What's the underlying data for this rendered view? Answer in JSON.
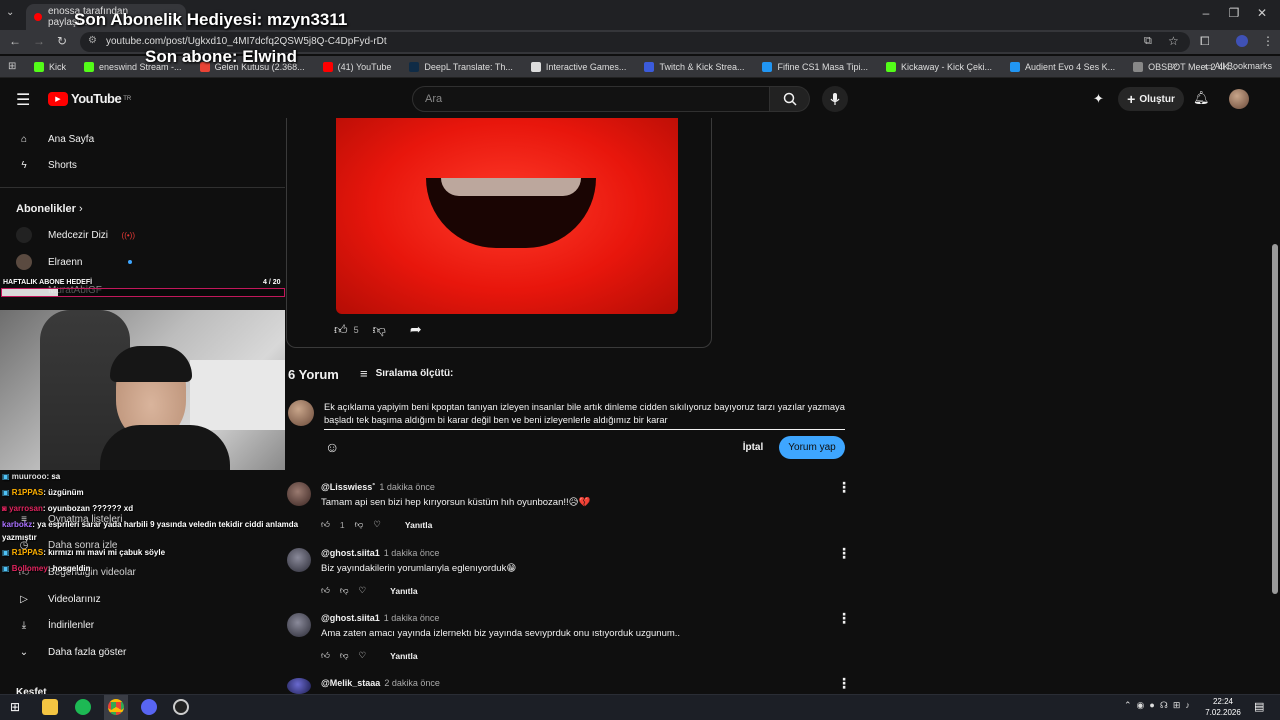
{
  "browser": {
    "tab_title": "enossa tarafından paylaşıl...",
    "tab_close": "×",
    "url": "youtube.com/post/Ugkxd10_4MI7dcfq2QSW5j8Q-C4DpFyd-rDt",
    "bookmarks": [
      {
        "label": "Kick",
        "color": "#53fc18"
      },
      {
        "label": "eneswind Stream -...",
        "color": "#53fc18"
      },
      {
        "label": "Gelen Kutusu (2.368...",
        "color": "#ea4335"
      },
      {
        "label": "(41) YouTube",
        "color": "#ff0000"
      },
      {
        "label": "DeepL Translate: Th...",
        "color": "#0f2b46"
      },
      {
        "label": "Interactive Games...",
        "color": "#dddddd"
      },
      {
        "label": "Twitch & Kick Strea...",
        "color": "#3b5bdb"
      },
      {
        "label": "Fifine CS1 Masa Tipi...",
        "color": "#2196f3"
      },
      {
        "label": "Kickaway - Kick Çeki...",
        "color": "#53fc18"
      },
      {
        "label": "Audient Evo 4 Ses K...",
        "color": "#2196f3"
      },
      {
        "label": "OBSBOT Meet 2 4K...",
        "color": "#888888"
      }
    ],
    "all_bookmarks": "All Bookmarks"
  },
  "overlay": {
    "gift": "Son Abonelik Hediyesi: mzyn3311",
    "sub": "Son abone: Elwind",
    "goal_label": "HAFTALIK ABONE HEDEFİ",
    "goal_count": "4",
    "goal_total": "/ 20",
    "goal_progress": 0.2
  },
  "masthead": {
    "logo": "YouTube",
    "logo_sup": "TR",
    "search_placeholder": "Ara",
    "create_label": "Oluştur"
  },
  "sidebar": {
    "home": "Ana Sayfa",
    "shorts": "Shorts",
    "subs_header": "Abonelikler",
    "subs": [
      {
        "name": "Medcezir Dizi"
      },
      {
        "name": "Elraenn"
      },
      {
        "name": "MuratAbiGF"
      }
    ],
    "you_items": [
      "Oynatma listeleri",
      "Daha sonra izle",
      "Beğendiğin videolar",
      "Videolarınız",
      "İndirilenler",
      "Daha fazla göster"
    ],
    "explore_header": "Keşfet"
  },
  "chat": [
    {
      "user": "muurooo",
      "msg": ": sa",
      "color": "#dddddd"
    },
    {
      "user": "R1PPAS",
      "msg": ": üzgünüm",
      "color": "#ffb000"
    },
    {
      "user": "yarrosan",
      "msg": ": oyunbozan ?????? xd",
      "color": "#e0245e"
    },
    {
      "user": "karbokz",
      "msg": ": ya esprileri sarar yada harbili 9 yasında veledin tekidir ciddi anlamda",
      "color": "#a970ff"
    },
    {
      "user": "",
      "msg": "yazmıştır",
      "color": "#ffffff"
    },
    {
      "user": "R1PPAS",
      "msg": ": kırmızı mı mavi mi çabuk söyle",
      "color": "#ffb000"
    },
    {
      "user": "Bollomey",
      "msg": ": hosgeldin",
      "color": "#e0245e"
    }
  ],
  "post": {
    "likes": "5"
  },
  "comments_section": {
    "count_label": "6 Yorum",
    "sort_label": "Sıralama ölçütü:",
    "draft": "Ek açıklama yapiyim beni kpoptan tanıyan izleyen insanlar bile artık dinleme cidden sıkılıyoruz bayıyoruz tarzı yazılar yazmaya başladı tek başıma aldığım bi karar değil ben ve beni izleyenlerle aldığımız bir karar",
    "cancel": "İptal",
    "submit": "Yorum yap"
  },
  "comments": [
    {
      "author": "@Lisswiess",
      "time": "1 dakika önce",
      "text": "Tamam api sen bizi hep kırıyorsun küstüm hıh oyunbozan!!😥💔",
      "likes": "1",
      "reply": "Yanıtla",
      "avatar": "#5a3b3b"
    },
    {
      "author": "@ghost.siita1",
      "time": "1 dakika önce",
      "text": "Biz yayındakilerin yorumlarıyla eglenıyorduk😁",
      "likes": "",
      "reply": "Yanıtla",
      "avatar": "#4a4a5a"
    },
    {
      "author": "@ghost.siita1",
      "time": "1 dakika önce",
      "text": "Ama zaten amacı yayında izlernektı biz yayında sevıyprduk onu ıstıyorduk uzgunum..",
      "likes": "",
      "reply": "Yanıtla",
      "avatar": "#4a4a5a"
    },
    {
      "author": "@Melik_staaa",
      "time": "2 dakika önce",
      "text": "",
      "likes": "",
      "reply": "",
      "avatar": "#3b3b8a"
    }
  ],
  "taskbar": {
    "time": "22:24",
    "date": "7.02.2026"
  }
}
